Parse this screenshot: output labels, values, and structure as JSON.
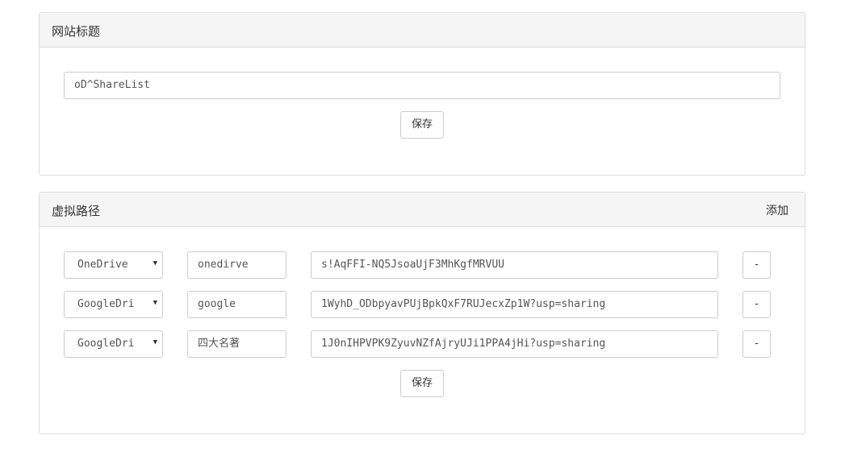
{
  "site_title_panel": {
    "heading": "网站标题",
    "title_value": "oD^ShareList",
    "save_label": "保存"
  },
  "virtual_path_panel": {
    "heading": "虚拟路径",
    "add_label": "添加",
    "rows": [
      {
        "drive": "OneDrive",
        "path": "onedirve",
        "share_id": "s!AqFFI-NQ5JsoaUjF3MhKgfMRVUU",
        "remove_label": "-"
      },
      {
        "drive": "GoogleDri",
        "path": "google",
        "share_id": "1WyhD_ODbpyavPUjBpkQxF7RUJecxZp1W?usp=sharing",
        "remove_label": "-"
      },
      {
        "drive": "GoogleDri",
        "path": "四大名著",
        "share_id": "1J0nIHPVPK9ZyuvNZfAjryUJi1PPA4jHi?usp=sharing",
        "remove_label": "-"
      }
    ],
    "save_label": "保存"
  },
  "icons": {
    "dropdown": "caret-down-icon"
  }
}
